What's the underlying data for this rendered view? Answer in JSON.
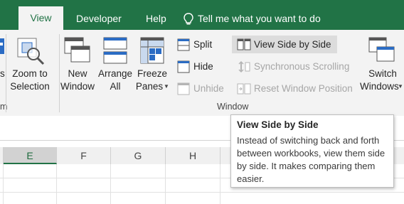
{
  "tabs": {
    "view": "View",
    "developer": "Developer",
    "help": "Help",
    "tell_me": "Tell me what you want to do"
  },
  "ribbon": {
    "zoom_to_selection": [
      "Zoom to",
      "Selection"
    ],
    "new_window": [
      "New",
      "Window"
    ],
    "arrange_all": [
      "Arrange",
      "All"
    ],
    "freeze_panes": [
      "Freeze",
      "Panes"
    ],
    "split": "Split",
    "hide": "Hide",
    "unhide": "Unhide",
    "view_side_by_side": "View Side by Side",
    "synchronous_scrolling": "Synchronous Scrolling",
    "reset_window_position": "Reset Window Position",
    "switch_windows": [
      "Switch",
      "Windows"
    ],
    "window_group_label": "Window",
    "prev_group_fragment": [
      "s",
      "m"
    ]
  },
  "columns": [
    "E",
    "F",
    "G",
    "H"
  ],
  "tooltip": {
    "title": "View Side by Side",
    "body": "Instead of switching back and forth between workbooks, view them side by side. It makes comparing them easier."
  },
  "colors": {
    "accent": "#217346",
    "ribbon_bg": "#f3f3f3",
    "hover_bg": "#dcdcdc"
  }
}
